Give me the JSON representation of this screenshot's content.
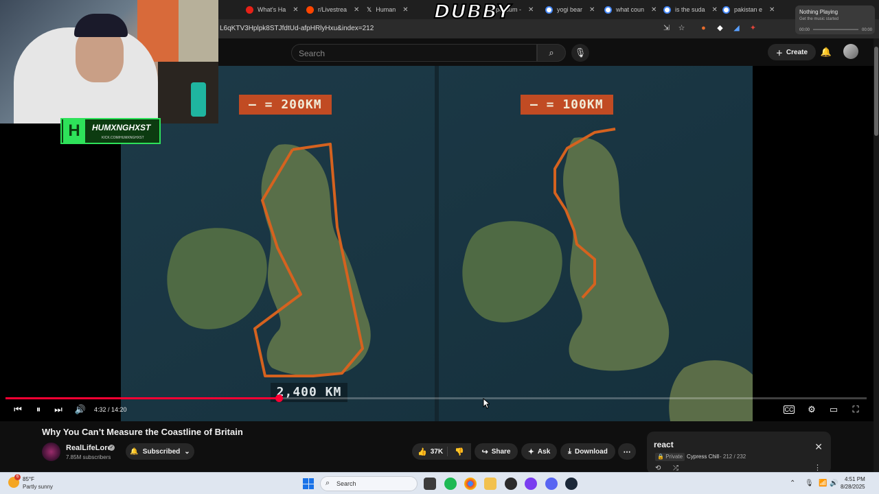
{
  "browser": {
    "tabs": [
      {
        "label": "What's Ha",
        "fav_color": "#e62117"
      },
      {
        "label": "r/Livestrea",
        "fav_color": "#ff4500"
      },
      {
        "label": "Human",
        "fav_color": "#111111"
      },
      {
        "label": "possum -",
        "fav_color": "#888888"
      },
      {
        "label": "yogi bear",
        "fav_color": "#4285f4"
      },
      {
        "label": "what coun",
        "fav_color": "#4285f4"
      },
      {
        "label": "is the suda",
        "fav_color": "#4285f4"
      },
      {
        "label": "pakistan e",
        "fav_color": "#4285f4"
      }
    ],
    "url": "L6qKTV3Hplpk8STJfdtUd-afpHRlyHxu&index=212"
  },
  "overlay": {
    "watermark": "DUBBY",
    "streamer_name": "HUMXNGHXST",
    "streamer_url": "KICK.COM/HUMXNGHXST",
    "logo_letter": "H"
  },
  "media_widget": {
    "title": "Nothing Playing",
    "subtitle": "Get the music started",
    "time_left": "00:00",
    "time_right": "00:00"
  },
  "yt_header": {
    "search_placeholder": "Search",
    "create_label": "Create"
  },
  "video": {
    "scale_left": "— = 200KM",
    "scale_right": "— = 100KM",
    "distance_label": "2,400 KM",
    "current_time": "4:32",
    "duration": "14:20",
    "timecode": "4:32 / 14:20",
    "progress": 0.317,
    "accent_color": "#ff0033"
  },
  "info": {
    "title": "Why You Can’t Measure the Coastline of Britain",
    "channel": "RealLifeLore",
    "subscribers": "7.85M subscribers",
    "subscribed_label": "Subscribed",
    "likes": "37K",
    "share_label": "Share",
    "ask_label": "Ask",
    "download_label": "Download"
  },
  "playlist": {
    "title": "react",
    "privacy": "Private",
    "owner": "Cypress Chill",
    "count": "212 / 232"
  },
  "taskbar": {
    "temperature": "85°F",
    "weather": "Partly sunny",
    "weather_badge": "6",
    "search_label": "Search",
    "time": "4:51 PM",
    "date": "8/28/2025"
  }
}
